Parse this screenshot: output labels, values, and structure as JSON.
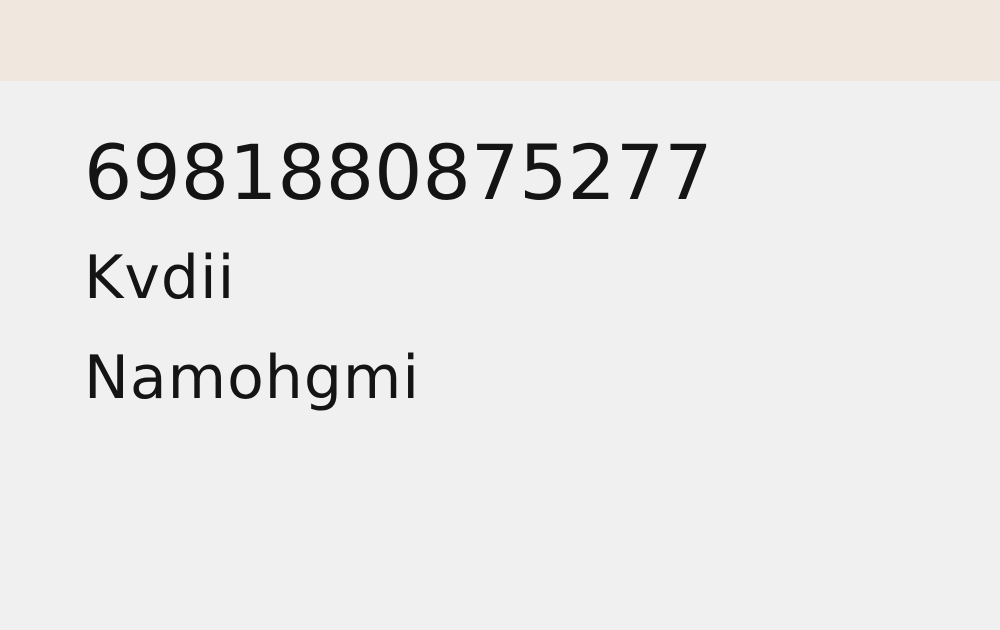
{
  "header": {
    "background": "#f0e7df"
  },
  "main": {
    "background": "#f0f0f0",
    "text_color": "#141414",
    "lines": [
      "6981880875277",
      "Kvdii",
      "Namohgmi"
    ]
  }
}
